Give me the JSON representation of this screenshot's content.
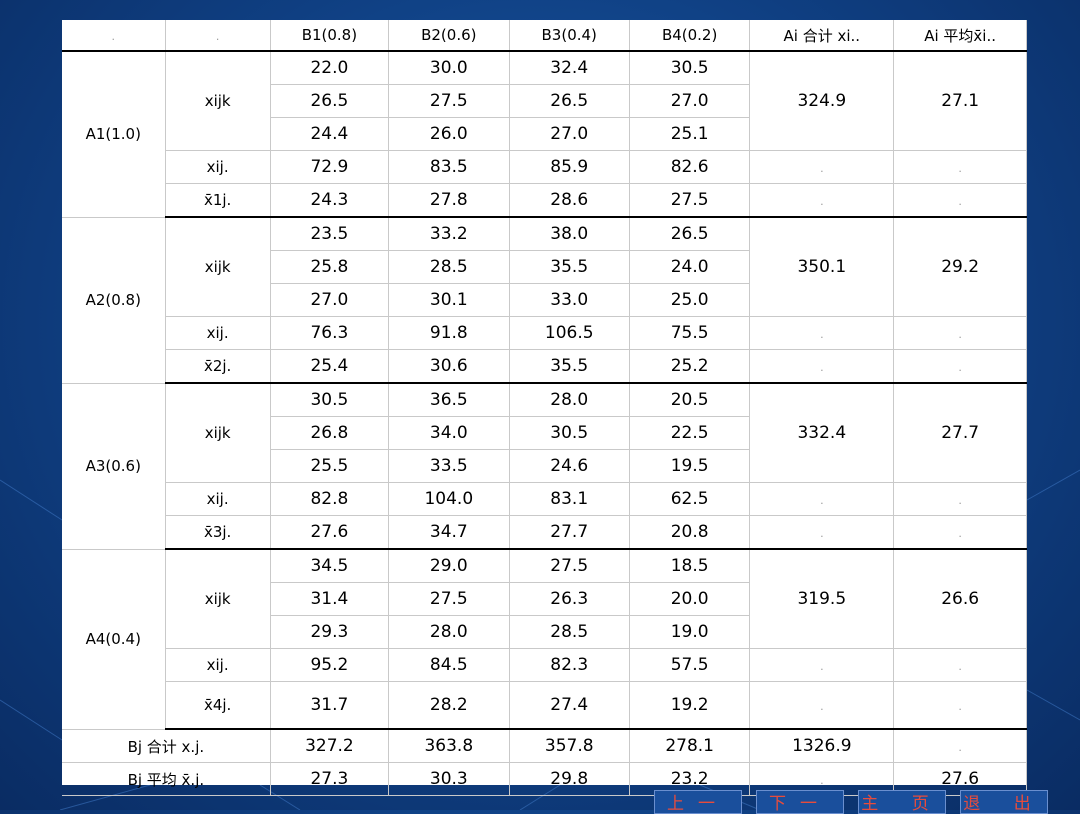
{
  "header": [
    "",
    "",
    "B1(0.8)",
    "B2(0.6)",
    "B3(0.4)",
    "B4(0.2)",
    "Ai 合计 xi..",
    "Ai 平均x̄i.."
  ],
  "blocks": [
    {
      "label": "A1(1.0)",
      "sub_label": "xijk",
      "rows": [
        [
          "22.0",
          "30.0",
          "32.4",
          "30.5"
        ],
        [
          "26.5",
          "27.5",
          "26.5",
          "27.0"
        ],
        [
          "24.4",
          "26.0",
          "27.0",
          "25.1"
        ]
      ],
      "total": "324.9",
      "mean": "27.1",
      "sum_label": "xij.",
      "sums": [
        "72.9",
        "83.5",
        "85.9",
        "82.6"
      ],
      "avg_label": "x̄1j.",
      "avgs": [
        "24.3",
        "27.8",
        "28.6",
        "27.5"
      ]
    },
    {
      "label": "A2(0.8)",
      "sub_label": "xijk",
      "rows": [
        [
          "23.5",
          "33.2",
          "38.0",
          "26.5"
        ],
        [
          "25.8",
          "28.5",
          "35.5",
          "24.0"
        ],
        [
          "27.0",
          "30.1",
          "33.0",
          "25.0"
        ]
      ],
      "total": "350.1",
      "mean": "29.2",
      "sum_label": "xij.",
      "sums": [
        "76.3",
        "91.8",
        "106.5",
        "75.5"
      ],
      "avg_label": "x̄2j.",
      "avgs": [
        "25.4",
        "30.6",
        "35.5",
        "25.2"
      ]
    },
    {
      "label": "A3(0.6)",
      "sub_label": "xijk",
      "rows": [
        [
          "30.5",
          "36.5",
          "28.0",
          "20.5"
        ],
        [
          "26.8",
          "34.0",
          "30.5",
          "22.5"
        ],
        [
          "25.5",
          "33.5",
          "24.6",
          "19.5"
        ]
      ],
      "total": "332.4",
      "mean": "27.7",
      "sum_label": "xij.",
      "sums": [
        "82.8",
        "104.0",
        "83.1",
        "62.5"
      ],
      "avg_label": "x̄3j.",
      "avgs": [
        "27.6",
        "34.7",
        "27.7",
        "20.8"
      ]
    },
    {
      "label": "A4(0.4)",
      "sub_label": "xijk",
      "rows": [
        [
          "34.5",
          "29.0",
          "27.5",
          "18.5"
        ],
        [
          "31.4",
          "27.5",
          "26.3",
          "20.0"
        ],
        [
          "29.3",
          "28.0",
          "28.5",
          "19.0"
        ]
      ],
      "total": "319.5",
      "mean": "26.6",
      "sum_label": "xij.",
      "sums": [
        "95.2",
        "84.5",
        "82.3",
        "57.5"
      ],
      "avg_label": "x̄4j.",
      "avgs": [
        "31.7",
        "28.2",
        "27.4",
        "19.2"
      ]
    }
  ],
  "footer": {
    "total_label": "Bj 合计 x.j.",
    "totals": [
      "327.2",
      "363.8",
      "357.8",
      "278.1",
      "1326.9",
      ""
    ],
    "mean_label": "Bj 平均 x̄.j.",
    "means": [
      "27.3",
      "30.3",
      "29.8",
      "23.2",
      "",
      "27.6"
    ]
  },
  "cell_mark": ".",
  "nav": [
    "上一张",
    "下一张",
    "主 页",
    "退 出"
  ],
  "colors": {
    "background": "#0f3f82",
    "nav_text": "#e74c3c"
  }
}
